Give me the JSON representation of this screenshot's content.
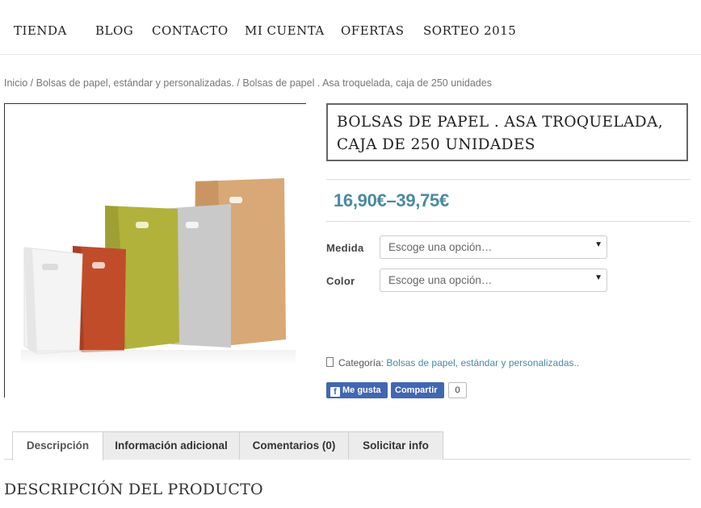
{
  "nav": {
    "items": [
      "TIENDA",
      "BLOG",
      "CONTACTO",
      "MI CUENTA",
      "OFERTAS",
      "SORTEO 2015"
    ]
  },
  "breadcrumb": {
    "items": [
      "Inicio",
      "Bolsas de papel, estándar y personalizadas.",
      "Bolsas de papel . Asa troquelada, caja de 250 unidades"
    ],
    "separator": "/"
  },
  "product": {
    "title_line1": "BOLSAS DE PAPEL . ASA TROQUELADA,",
    "title_line2": "CAJA DE 250 UNIDADES",
    "price": "16,90€–39,75€",
    "price_color": "#4a8aa0",
    "image_icon": "paper-bags-image",
    "fields": [
      {
        "label": "Medida",
        "value": "Escoge una opción…"
      },
      {
        "label": "Color",
        "value": "Escoge una opción…"
      }
    ],
    "category_label": "Categoría:",
    "category_link": "Bolsas de papel, estándar y personalizadas.",
    "category_suffix": "."
  },
  "social": {
    "like_label": "Me gusta",
    "share_label": "Compartir",
    "count": "0",
    "brand_color": "#4267b2"
  },
  "tabs": [
    "Descripción",
    "Información adicional",
    "Comentarios (0)",
    "Solicitar info"
  ],
  "active_tab": "Descripción",
  "description": {
    "heading": "DESCRIPCIÓN DEL PRODUCTO"
  }
}
